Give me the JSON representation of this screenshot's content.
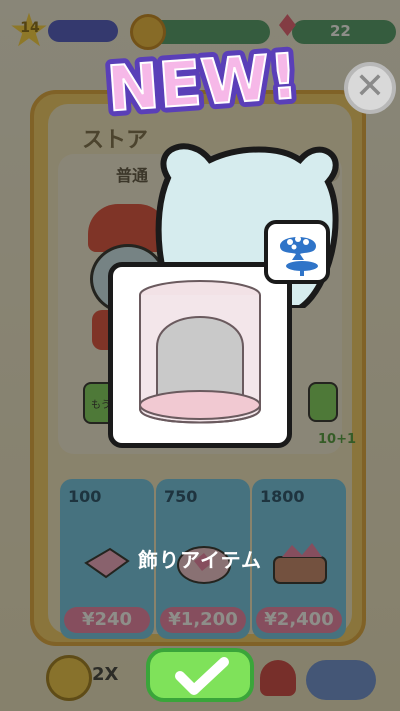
{
  "header": {
    "level": "14",
    "gems": "22"
  },
  "shop": {
    "title": "ストア",
    "section_label": "普通",
    "info_icon": "info-icon",
    "draw_button_label": "もう",
    "bonus_label": "10+1",
    "offers": [
      {
        "amount": "100",
        "price": "¥240"
      },
      {
        "amount": "750",
        "price": "¥1,200"
      },
      {
        "amount": "1800",
        "price": "¥2,400"
      }
    ]
  },
  "bottom": {
    "multiplier": "2X"
  },
  "popup": {
    "banner": "NEW!",
    "item_category": "飾りアイテム",
    "category_icon": "palette-table-icon",
    "close_icon": "close-icon",
    "confirm_icon": "checkmark-icon"
  },
  "colors": {
    "banner_fill": "#f6b8e8",
    "banner_outline": "#5a3fb8",
    "confirm_green": "#7fe25a",
    "price_pink": "#ee7fa8",
    "offer_blue": "#6fc7ea"
  }
}
